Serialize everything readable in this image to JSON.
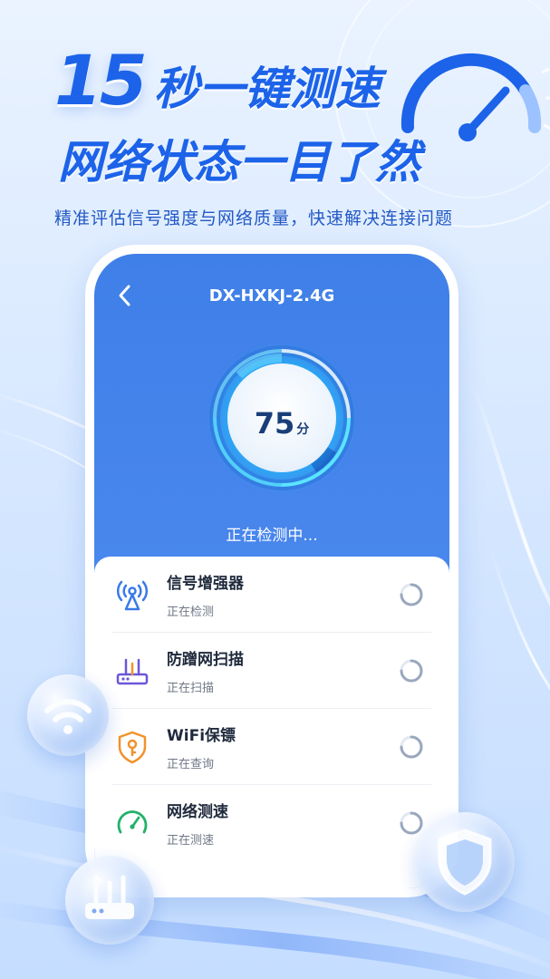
{
  "headline": {
    "number": "15",
    "line1_rest": "秒一键测速",
    "line2": "网络状态一目了然"
  },
  "subtitle": "精准评估信号强度与网络质量，快速解决连接问题",
  "app": {
    "network_name": "DX-HXKJ-2.4G",
    "score": {
      "value": "75",
      "unit": "分"
    },
    "status": "正在检测中...",
    "items": [
      {
        "icon": "signal-tower-icon",
        "title": "信号增强器",
        "subtitle": "正在检测"
      },
      {
        "icon": "router-icon",
        "title": "防蹭网扫描",
        "subtitle": "正在扫描"
      },
      {
        "icon": "shield-key-icon",
        "title": "WiFi保镖",
        "subtitle": "正在查询"
      },
      {
        "icon": "speedometer-icon",
        "title": "网络测速",
        "subtitle": "正在测速"
      }
    ]
  },
  "colors": {
    "brand_blue": "#1c63e9",
    "screen_blue": "#4b89ee",
    "icon_blue": "#3a7ae8",
    "icon_purple": "#6b57d8",
    "icon_orange": "#f2922b",
    "icon_green": "#23b26b"
  },
  "decor": {
    "floating_icons": [
      "wifi-icon",
      "router-icon",
      "shield-icon"
    ]
  }
}
